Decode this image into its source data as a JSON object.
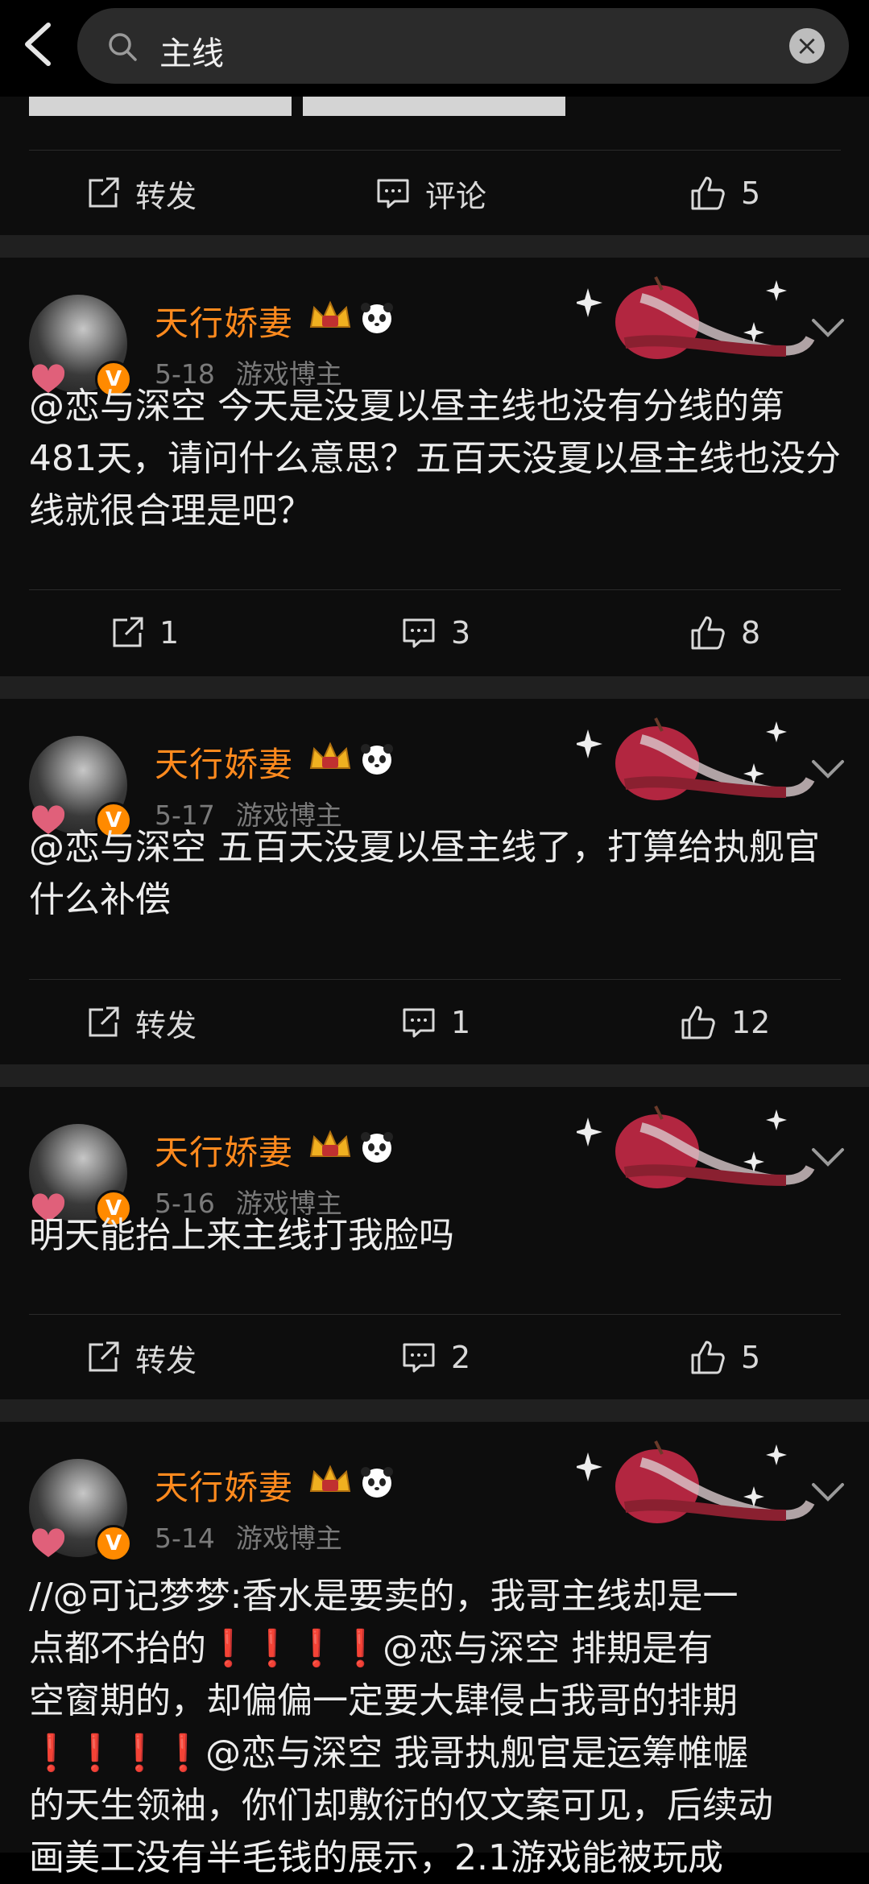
{
  "search": {
    "query": "主线"
  },
  "actions_label": {
    "repost": "转发",
    "comment": "评论"
  },
  "first_card": {
    "like_count": "5"
  },
  "posts": [
    {
      "username": "天行娇妻",
      "date": "5-18",
      "tag": "游戏博主",
      "text": "@恋与深空 今天是没夏以昼主线也没有分线的第481天，请问什么意思？五百天没夏以昼主线也没分线就很合理是吧？",
      "repost": "1",
      "comment": "3",
      "like": "8"
    },
    {
      "username": "天行娇妻",
      "date": "5-17",
      "tag": "游戏博主",
      "text": "@恋与深空 五百天没夏以昼主线了，打算给执舰官什么补偿",
      "repost": "转发",
      "comment": "1",
      "like": "12"
    },
    {
      "username": "天行娇妻",
      "date": "5-16",
      "tag": "游戏博主",
      "text": "明天能抬上来主线打我脸吗",
      "repost": "转发",
      "comment": "2",
      "like": "5"
    },
    {
      "username": "天行娇妻",
      "date": "5-14",
      "tag": "游戏博主",
      "text_line1": "//@可记梦梦:香水是要卖的，我哥主线却是一",
      "text_line2a": "点都不抬的",
      "text_excl": "❗❗❗❗",
      "text_line2b": "@恋与深空 排期是有",
      "text_line3": "空窗期的，却偏偏一定要大肆侵占我哥的排期",
      "text_line4b": "@恋与深空 我哥执舰官是运筹帷幄",
      "text_line5": "的天生领袖，你们却敷衍的仅文案可见，后续动",
      "text_line6": "画美工没有半毛钱的展示，2.1游戏能被玩成"
    }
  ],
  "colors": {
    "username": "#ff8a1e",
    "verified": "#ff8a00",
    "exclaim": "#e0282c"
  }
}
